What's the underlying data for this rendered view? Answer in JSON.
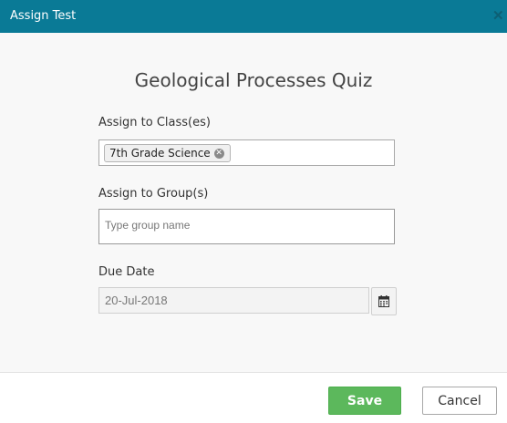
{
  "dialog": {
    "title": "Assign Test",
    "close_icon": "close-icon"
  },
  "form": {
    "heading": "Geological Processes Quiz",
    "classes_label": "Assign to Class(es)",
    "selected_classes": [
      "7th Grade Science"
    ],
    "groups_label": "Assign to Group(s)",
    "groups_placeholder": "Type group name",
    "groups_value": "",
    "due_date_label": "Due Date",
    "due_date_value": "20-Jul-2018",
    "calendar_icon": "calendar-icon"
  },
  "footer": {
    "save_label": "Save",
    "cancel_label": "Cancel"
  },
  "colors": {
    "titlebar": "#0a7a96",
    "save_button": "#5cb85c"
  }
}
